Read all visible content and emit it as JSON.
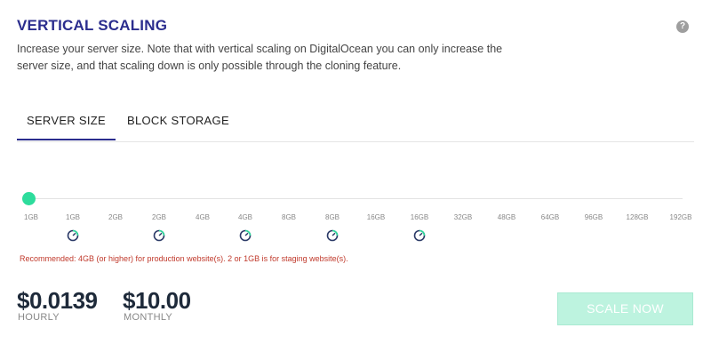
{
  "header": {
    "title": "VERTICAL SCALING",
    "help_icon": "?",
    "description": "Increase your server size. Note that with vertical scaling on DigitalOcean you can only increase the server size, and that scaling down is only possible through the cloning feature."
  },
  "tabs": [
    {
      "label": "SERVER SIZE",
      "active": true
    },
    {
      "label": "BLOCK STORAGE",
      "active": false
    }
  ],
  "slider": {
    "selected_index": 0,
    "ticks": [
      "1GB",
      "1GB",
      "2GB",
      "2GB",
      "4GB",
      "4GB",
      "8GB",
      "8GB",
      "16GB",
      "16GB",
      "32GB",
      "48GB",
      "64GB",
      "96GB",
      "128GB",
      "192GB"
    ],
    "gauge_icon": "gauge-icon",
    "handle_color": "#2ddc9c"
  },
  "recommendation": "Recommended: 4GB (or higher) for production website(s). 2 or 1GB is for staging website(s).",
  "pricing": {
    "hourly_value": "$0.0139",
    "hourly_label": "HOURLY",
    "monthly_value": "$10.00",
    "monthly_label": "MONTHLY"
  },
  "actions": {
    "scale_label": "SCALE NOW",
    "scale_color": "#bdf3df"
  },
  "colors": {
    "accent": "#2b2d8e",
    "warning": "#c0392b"
  }
}
